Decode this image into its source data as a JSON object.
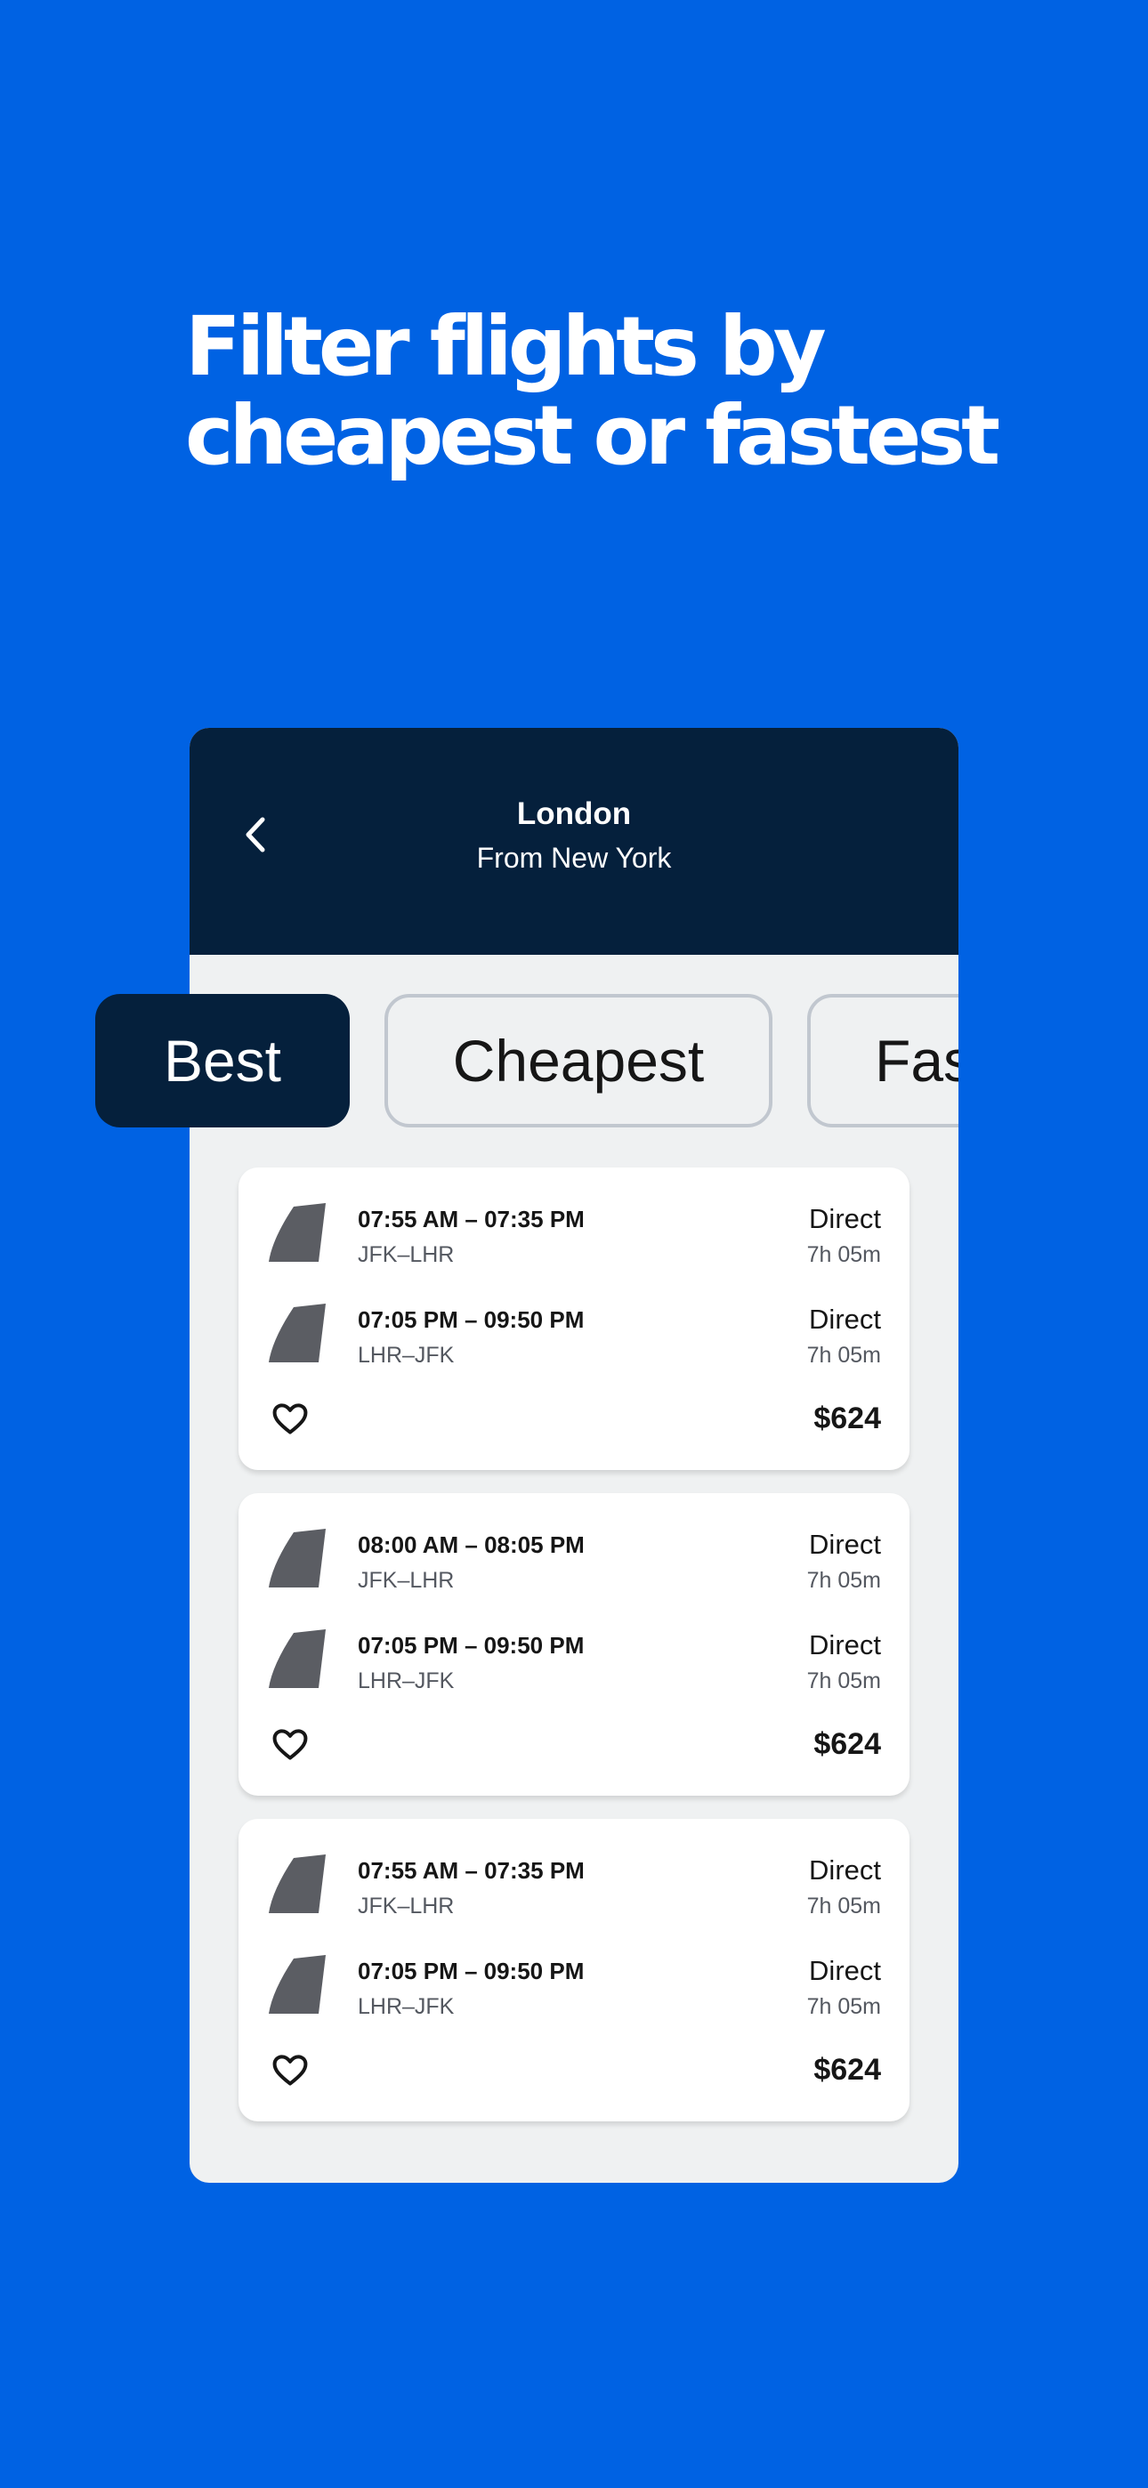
{
  "headline": {
    "line1": "Filter flights by",
    "line2": "cheapest or fastest"
  },
  "header": {
    "title": "London",
    "subtitle": "From New York",
    "back_icon": "chevron-left-icon"
  },
  "sort_tabs": [
    {
      "label": "Best",
      "selected": true
    },
    {
      "label": "Cheapest",
      "selected": false
    },
    {
      "label": "Fastest",
      "selected": false
    }
  ],
  "results": [
    {
      "legs": [
        {
          "times": "07:55 AM – 07:35 PM",
          "route": "JFK–LHR",
          "stops": "Direct",
          "duration": "7h 05m"
        },
        {
          "times": "07:05 PM – 09:50 PM",
          "route": "LHR–JFK",
          "stops": "Direct",
          "duration": "7h 05m"
        }
      ],
      "price": "$624"
    },
    {
      "legs": [
        {
          "times": "08:00 AM – 08:05 PM",
          "route": "JFK–LHR",
          "stops": "Direct",
          "duration": "7h 05m"
        },
        {
          "times": "07:05 PM – 09:50 PM",
          "route": "LHR–JFK",
          "stops": "Direct",
          "duration": "7h 05m"
        }
      ],
      "price": "$624"
    },
    {
      "legs": [
        {
          "times": "07:55 AM – 07:35 PM",
          "route": "JFK–LHR",
          "stops": "Direct",
          "duration": "7h 05m"
        },
        {
          "times": "07:05 PM – 09:50 PM",
          "route": "LHR–JFK",
          "stops": "Direct",
          "duration": "7h 05m"
        }
      ],
      "price": "$624"
    }
  ],
  "colors": {
    "background": "#0062E3",
    "header": "#05203C",
    "selected_chip": "#05203C",
    "panel": "#EFF1F2",
    "airline_tail": "#5B5D63"
  }
}
